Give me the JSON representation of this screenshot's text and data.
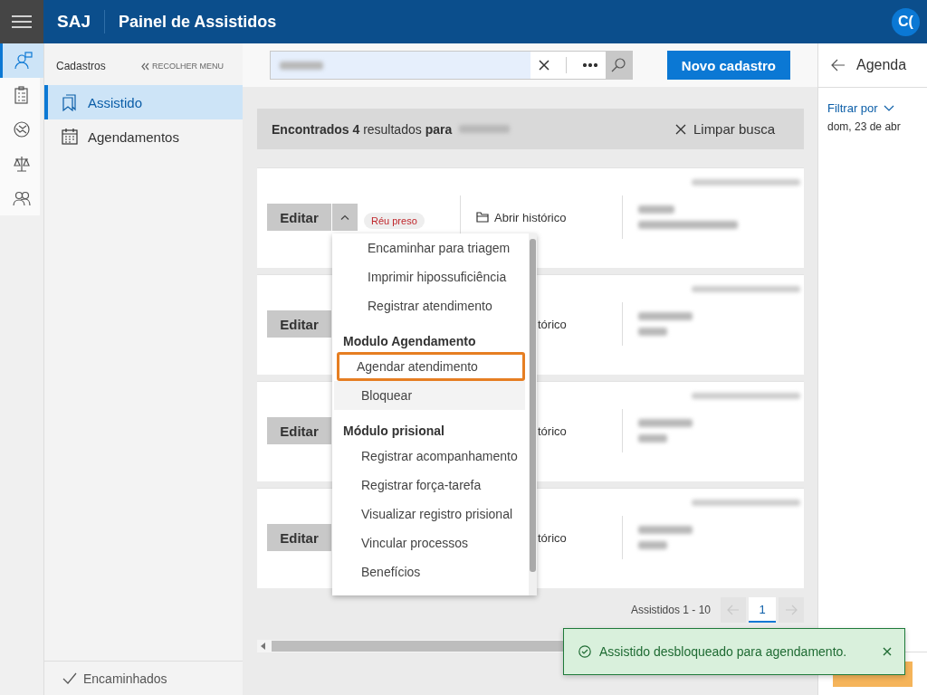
{
  "header": {
    "brand": "SAJ",
    "title": "Painel de Assistidos",
    "avatar": "C("
  },
  "rail": [
    {
      "selected": true
    },
    {
      "selected": false
    },
    {
      "selected": false
    },
    {
      "selected": false
    },
    {
      "selected": false
    }
  ],
  "sidebar": {
    "title": "Cadastros",
    "collapse": "RECOLHER MENU",
    "items": [
      {
        "label": "Assistido",
        "selected": true
      },
      {
        "label": "Agendamentos",
        "selected": false
      }
    ],
    "footer": "Encaminhados"
  },
  "new_button": "Novo cadastro",
  "results": {
    "text": "**Encontrados 4** resultados **para**",
    "clear": "Limpar busca"
  },
  "cards": [
    {
      "edit": "Editar",
      "caret": {
        "expanded": true
      },
      "badge": "Réu preso",
      "history": "Abrir histórico",
      "history_clipped": false
    },
    {
      "edit": "Editar",
      "history": "tórico",
      "history_clipped": true
    },
    {
      "edit": "Editar",
      "history": "tórico",
      "history_clipped": true
    },
    {
      "edit": "Editar",
      "history": "tórico",
      "history_clipped": true
    }
  ],
  "menu": [
    {
      "kind": "item",
      "label": "Encaminhar para triagem",
      "indent": true,
      "highlighted": false,
      "hovered": false
    },
    {
      "kind": "item",
      "label": "Imprimir hipossuficiência",
      "indent": true,
      "highlighted": false,
      "hovered": false
    },
    {
      "kind": "item",
      "label": "Registrar atendimento",
      "indent": true,
      "highlighted": false,
      "hovered": false
    },
    {
      "kind": "header",
      "label": "Modulo Agendamento"
    },
    {
      "kind": "item",
      "label": "Agendar atendimento",
      "indent": false,
      "highlighted": true,
      "hovered": false
    },
    {
      "kind": "item",
      "label": "Bloquear",
      "indent": false,
      "highlighted": false,
      "hovered": true
    },
    {
      "kind": "header",
      "label": "Módulo prisional"
    },
    {
      "kind": "item",
      "label": "Registrar acompanhamento",
      "indent": false,
      "highlighted": false,
      "hovered": false
    },
    {
      "kind": "item",
      "label": "Registrar força-tarefa",
      "indent": false,
      "highlighted": false,
      "hovered": false
    },
    {
      "kind": "item",
      "label": "Visualizar registro prisional",
      "indent": false,
      "highlighted": false,
      "hovered": false
    },
    {
      "kind": "item",
      "label": "Vincular processos",
      "indent": false,
      "highlighted": false,
      "hovered": false
    },
    {
      "kind": "item",
      "label": "Benefícios",
      "indent": false,
      "highlighted": false,
      "hovered": false
    }
  ],
  "pagination": {
    "label": "Assistidos 1 - 10",
    "prev_disabled": true,
    "next_disabled": true,
    "pages": [
      {
        "label": "1",
        "selected": true
      }
    ]
  },
  "toast": {
    "message": "Assistido desbloqueado para agendamento."
  },
  "agenda": {
    "title": "Agenda",
    "filter": "Filtrar por",
    "date": "dom, 23 de abr"
  }
}
